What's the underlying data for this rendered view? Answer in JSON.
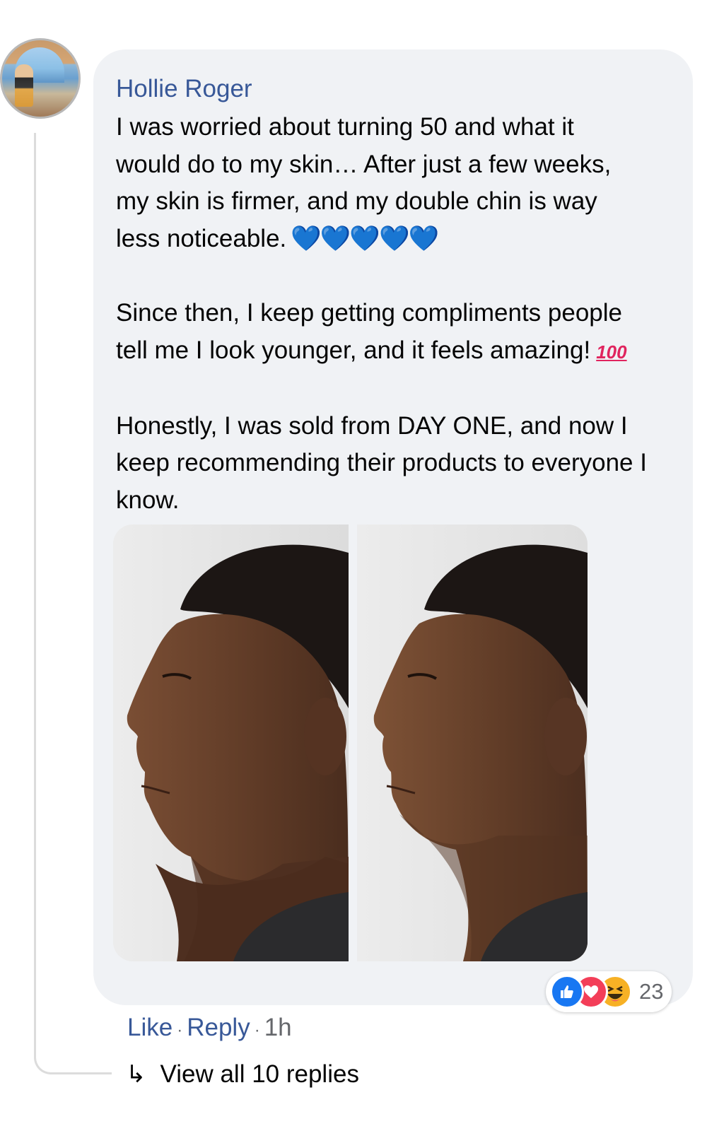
{
  "comment": {
    "author": "Hollie Roger",
    "paragraphs": [
      {
        "text": "I was worried about turning 50 and what it\nwould do to my skin… After just a few weeks,\nmy skin is firmer, and my double chin is way\nless noticeable.",
        "emoji": "💙💙💙💙💙",
        "emoji_name": "blue-hearts"
      },
      {
        "text": "Since then, I keep getting compliments people\ntell me I look younger, and it feels amazing!",
        "emoji": "100",
        "emoji_name": "hundred-points"
      },
      {
        "text": "Honestly, I was sold from DAY ONE, and now I\nkeep recommending their products to everyone I\nknow."
      }
    ],
    "photos": [
      {
        "name": "before-photo"
      },
      {
        "name": "after-photo"
      }
    ]
  },
  "reactions": {
    "icons": [
      "like-icon",
      "love-icon",
      "haha-icon"
    ],
    "count": "23"
  },
  "actions": {
    "like": "Like",
    "reply": "Reply",
    "separator": "·",
    "time": "1h"
  },
  "replies": {
    "label": "View all 10 replies",
    "arrow": "↳"
  },
  "colors": {
    "bubble": "#f0f2f5",
    "link": "#385898",
    "meta": "#65676b",
    "like": "#1877f2",
    "love": "#f33e58",
    "haha": "#f7b125"
  }
}
